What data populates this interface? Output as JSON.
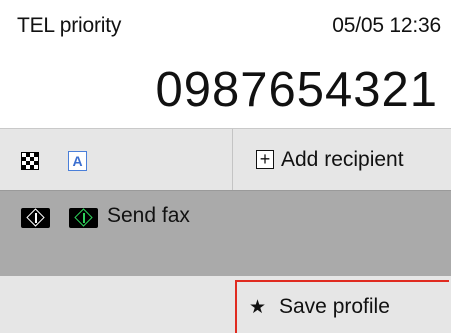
{
  "header": {
    "mode": "TEL priority",
    "datetime": "05/05 12:36"
  },
  "fax_number": "0987654321",
  "options": {
    "scan_quality_icon": "checker-icon",
    "color_mode_icon_text": "A",
    "add_recipient_label": "Add recipient",
    "add_recipient_icon": "plus-box-icon"
  },
  "send": {
    "label": "Send fax",
    "icons": [
      "start-black-icon",
      "start-color-icon"
    ],
    "accent_color": "#2ed15a"
  },
  "save": {
    "label": "Save profile",
    "icon": "star-plus-icon",
    "highlight_color": "#e02b20"
  }
}
